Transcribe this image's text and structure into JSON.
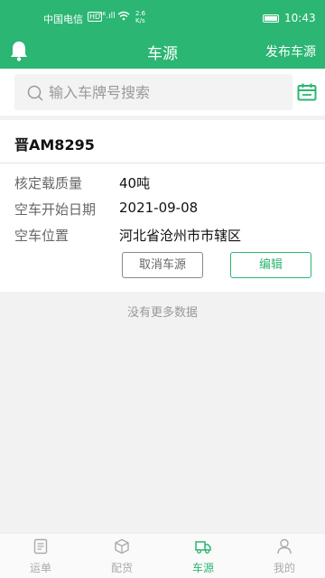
{
  "status_bar": {
    "carrier": "中国电信",
    "hd": "HD",
    "signal": "⁴⁶.ıll",
    "speed_value": "2.6",
    "speed_unit": "K/s",
    "time": "10:43"
  },
  "header": {
    "title": "车源",
    "action": "发布车源"
  },
  "search": {
    "placeholder": "输入车牌号搜索",
    "value": ""
  },
  "vehicle": {
    "plate": "晋AM8295",
    "fields": [
      {
        "label": "核定载质量",
        "value": "40吨"
      },
      {
        "label": "空车开始日期",
        "value": "2021-09-08"
      },
      {
        "label": "空车位置",
        "value": "河北省沧州市市辖区"
      }
    ],
    "cancel_label": "取消车源",
    "edit_label": "编辑"
  },
  "list_footer": "没有更多数据",
  "tabs": [
    {
      "label": "运单",
      "icon": "waybill-icon"
    },
    {
      "label": "配货",
      "icon": "cargo-box-icon"
    },
    {
      "label": "车源",
      "icon": "truck-icon",
      "active": true
    },
    {
      "label": "我的",
      "icon": "person-icon"
    }
  ],
  "colors": {
    "brand": "#2bb673",
    "background": "#f2f2f2"
  }
}
